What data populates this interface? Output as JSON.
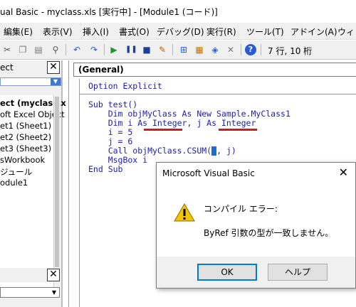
{
  "window": {
    "title": "ual Basic - myclass.xls [実行中] - [Module1 (コード)]"
  },
  "menu": [
    "編集(E)",
    "表示(V)",
    "挿入(I)",
    "書式(O)",
    "デバッグ(D)",
    "実行(R)",
    "ツール(T)",
    "アドイン(A)",
    "ウィン"
  ],
  "toolbar": {
    "position_status": "7 行, 10 桁"
  },
  "project_pane": {
    "header": "ect",
    "close_label": "✕",
    "tree": [
      "ect (myclass.x",
      "oft Excel Object",
      "et1 (Sheet1)",
      "et2 (Sheet2)",
      "et3 (Sheet3)",
      "sWorkbook",
      "ジュール",
      "odule1"
    ]
  },
  "properties_pane": {
    "close_label": "✕"
  },
  "code_window": {
    "procedure_combo": "(General)",
    "lines": [
      "Option Explicit",
      "Sub test()",
      "    Dim objMyClass As New Sample.MyClass1",
      "    Dim i As Integer, j As Integer",
      "    i = 5",
      "    j = 6",
      "    Call objMyClass.CSUM(",
      ", j)",
      "    MsgBox i",
      "End Sub"
    ]
  },
  "dialog": {
    "title": "Microsoft Visual Basic",
    "close_label": "✕",
    "heading": "コンパイル エラー:",
    "message": "ByRef 引数の型が一致しません。",
    "ok_label": "OK",
    "help_label": "ヘルプ",
    "icon": "warning-icon"
  },
  "colors": {
    "code_text": "#1c1cb0",
    "error_underline": "#d21a1a",
    "caret": "#1c6dd0",
    "warning": "#f5c400"
  }
}
